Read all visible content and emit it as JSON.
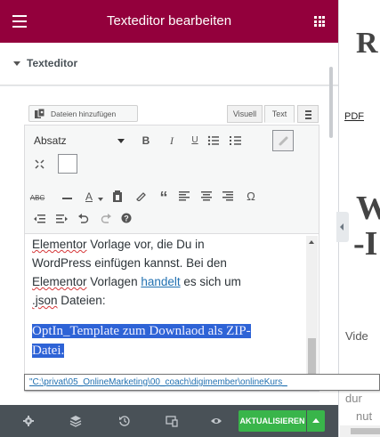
{
  "topbar": {
    "title": "Texteditor bearbeiten"
  },
  "section": {
    "title": "Texteditor"
  },
  "media": {
    "add_files_label": "Dateien hinzufügen"
  },
  "tabs": {
    "visual": "Visuell",
    "text": "Text"
  },
  "toolbar": {
    "format_value": "Absatz",
    "bold": "B",
    "italic": "I",
    "underline": "U",
    "quote": "“",
    "omega": "Ω",
    "abc": "ABC",
    "text_color": "A"
  },
  "editor_text": {
    "line1_word1": "Elementor",
    "line1_rest": " Vorlage vor, die Du in",
    "line2": "WordPress einfügen kannst. Bei den",
    "line3_word1": "Elementor",
    "line3_mid": " Vorlagen ",
    "line3_link": "handelt",
    "line3_rest": " es sich um",
    "line4_word1": ".json",
    "line4_rest": " Dateien:",
    "selected_line1": "OptIn_Template zum Downlaod als ZIP-",
    "selected_line2": "Datei."
  },
  "tooltip": {
    "path": "\"C:\\privat\\05_OnlineMarketing\\00_coach\\digimember\\onlineKurs_"
  },
  "bottombar": {
    "update_label": "AKTUALISIEREN"
  },
  "preview": {
    "heading1_fragment": "R",
    "pdf_link_fragment": "PDF",
    "heading2_fragment": "W",
    "heading2b_fragment": "-I",
    "para_fragment": "Vide",
    "para2_fragment": "dur",
    "para3_fragment": "nut"
  },
  "colors": {
    "topbar": "#93003c",
    "update_button": "#39b54a",
    "selection": "#2e63d6",
    "link": "#2271b1"
  }
}
